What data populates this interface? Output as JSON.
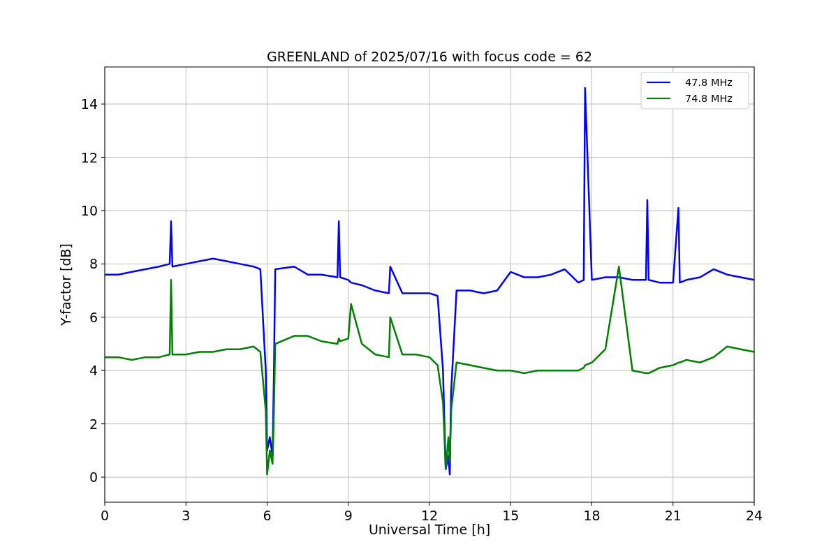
{
  "chart_data": {
    "type": "line",
    "title": "GREENLAND of 2025/07/16 with focus code = 62",
    "xlabel": "Universal Time [h]",
    "ylabel": "Y-factor [dB]",
    "x": [
      0,
      0.5,
      1,
      1.5,
      2,
      2.4,
      2.45,
      2.5,
      3,
      3.5,
      4,
      4.5,
      5,
      5.5,
      5.75,
      5.95,
      6,
      6.1,
      6.2,
      6.25,
      6.3,
      7,
      7.5,
      8,
      8.6,
      8.65,
      8.7,
      9,
      9.1,
      9.5,
      10,
      10.5,
      10.55,
      11,
      11.5,
      12,
      12.3,
      12.5,
      12.6,
      12.7,
      12.75,
      12.8,
      13,
      13.5,
      14,
      14.5,
      15,
      15.5,
      16,
      16.5,
      17,
      17.5,
      17.7,
      17.75,
      18,
      18.5,
      19,
      19.5,
      20,
      20.05,
      20.1,
      20.5,
      21,
      21.2,
      21.25,
      21.5,
      22,
      22.5,
      23,
      23.5,
      24
    ],
    "series": [
      {
        "name": "47.8 MHz",
        "color": "#0000ff",
        "values": [
          7.6,
          7.6,
          7.7,
          7.8,
          7.9,
          8.0,
          9.6,
          7.9,
          8.0,
          8.1,
          8.2,
          8.1,
          8.0,
          7.9,
          7.8,
          4.0,
          1.0,
          1.5,
          0.8,
          3.8,
          7.8,
          7.9,
          7.6,
          7.6,
          7.5,
          9.6,
          7.5,
          7.4,
          7.3,
          7.2,
          7.0,
          6.9,
          7.9,
          6.9,
          6.9,
          6.9,
          6.8,
          4.0,
          0.3,
          0.8,
          0.1,
          3.2,
          7.0,
          7.0,
          6.9,
          7.0,
          7.7,
          7.5,
          7.5,
          7.6,
          7.8,
          7.3,
          7.4,
          14.6,
          7.4,
          7.5,
          7.5,
          7.4,
          7.4,
          10.4,
          7.4,
          7.3,
          7.3,
          10.1,
          7.3,
          7.4,
          7.5,
          7.8,
          7.6,
          7.5,
          7.4
        ]
      },
      {
        "name": "74.8 MHz",
        "color": "#008000",
        "values": [
          4.5,
          4.5,
          4.4,
          4.5,
          4.5,
          4.6,
          7.4,
          4.6,
          4.6,
          4.7,
          4.7,
          4.8,
          4.8,
          4.9,
          4.7,
          2.5,
          0.1,
          1.0,
          0.5,
          2.4,
          5.0,
          5.3,
          5.3,
          5.1,
          5.0,
          5.2,
          5.1,
          5.2,
          6.5,
          5.0,
          4.6,
          4.5,
          6.0,
          4.6,
          4.6,
          4.5,
          4.2,
          2.8,
          0.3,
          1.5,
          0.6,
          2.5,
          4.3,
          4.2,
          4.1,
          4.0,
          4.0,
          3.9,
          4.0,
          4.0,
          4.0,
          4.0,
          4.1,
          4.2,
          4.3,
          4.8,
          7.9,
          4.0,
          3.9,
          3.9,
          3.9,
          4.1,
          4.2,
          4.3,
          4.3,
          4.4,
          4.3,
          4.5,
          4.9,
          4.8,
          4.7
        ]
      }
    ],
    "xlim": [
      0,
      24
    ],
    "ylim": [
      -0.94,
      15.39
    ],
    "xticks": [
      0,
      3,
      6,
      9,
      12,
      15,
      18,
      21,
      24
    ],
    "yticks": [
      0,
      2,
      4,
      6,
      8,
      10,
      12,
      14
    ],
    "grid": true,
    "legend": true
  }
}
